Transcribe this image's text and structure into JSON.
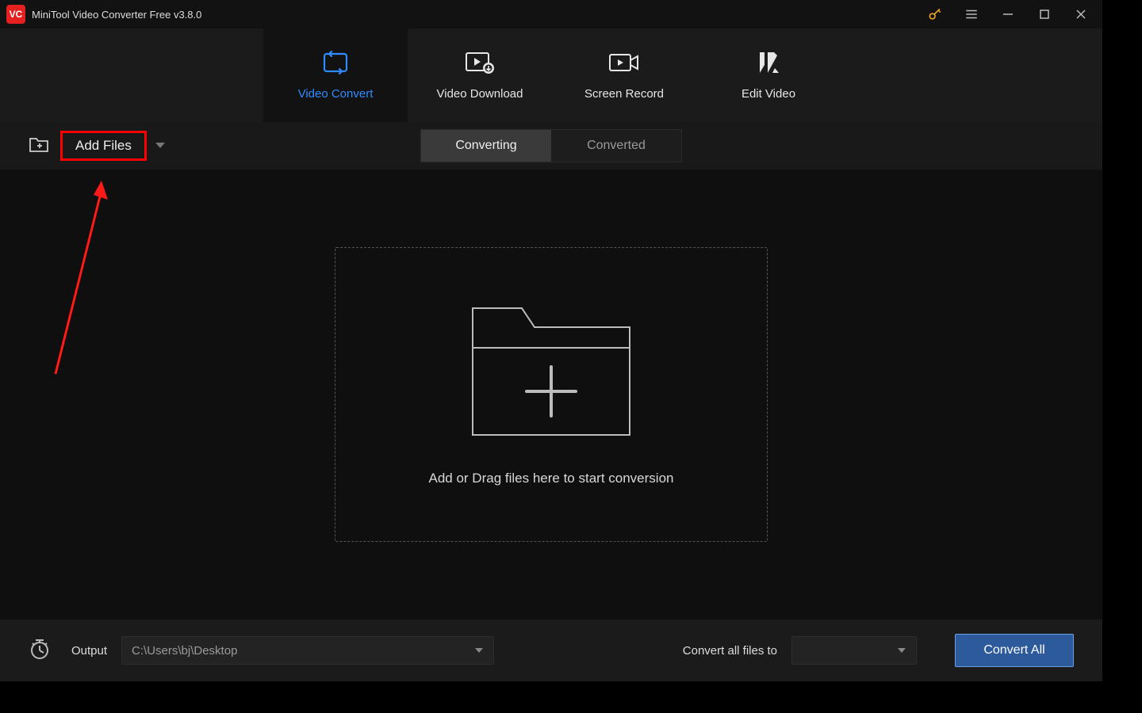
{
  "titlebar": {
    "title": "MiniTool Video Converter Free v3.8.0"
  },
  "nav": {
    "tabs": [
      {
        "label": "Video Convert"
      },
      {
        "label": "Video Download"
      },
      {
        "label": "Screen Record"
      },
      {
        "label": "Edit Video"
      }
    ]
  },
  "actionbar": {
    "add_files_label": "Add Files",
    "segments": [
      {
        "label": "Converting"
      },
      {
        "label": "Converted"
      }
    ]
  },
  "dropzone": {
    "text": "Add or Drag files here to start conversion"
  },
  "bottombar": {
    "output_label": "Output",
    "output_path": "C:\\Users\\bj\\Desktop",
    "convert_all_label": "Convert all files to",
    "format_selected": "",
    "convert_button": "Convert All"
  }
}
